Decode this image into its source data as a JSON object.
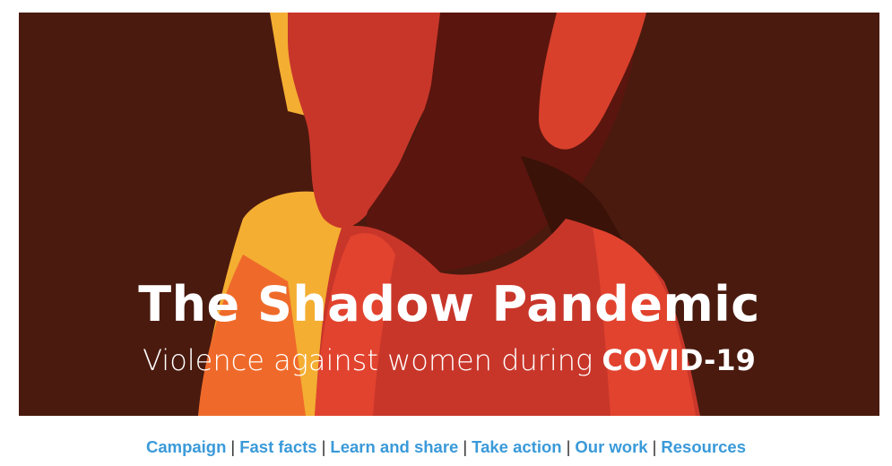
{
  "banner": {
    "title": "The Shadow Pandemic",
    "subtitle_main": "Violence against women during ",
    "subtitle_strong": "COVID-19",
    "colors": {
      "background": "#4a1a0e",
      "figure_yellow": "#f4ae32",
      "figure_red": "#c8362a",
      "figure_bright": "#e2432e",
      "hair_dark": "#5a150e"
    }
  },
  "nav": {
    "separator": "|",
    "links": [
      {
        "label": "Campaign"
      },
      {
        "label": "Fast facts"
      },
      {
        "label": "Learn and share"
      },
      {
        "label": "Take action"
      },
      {
        "label": "Our work"
      },
      {
        "label": "Resources"
      }
    ],
    "link_color": "#3a9ad9"
  }
}
